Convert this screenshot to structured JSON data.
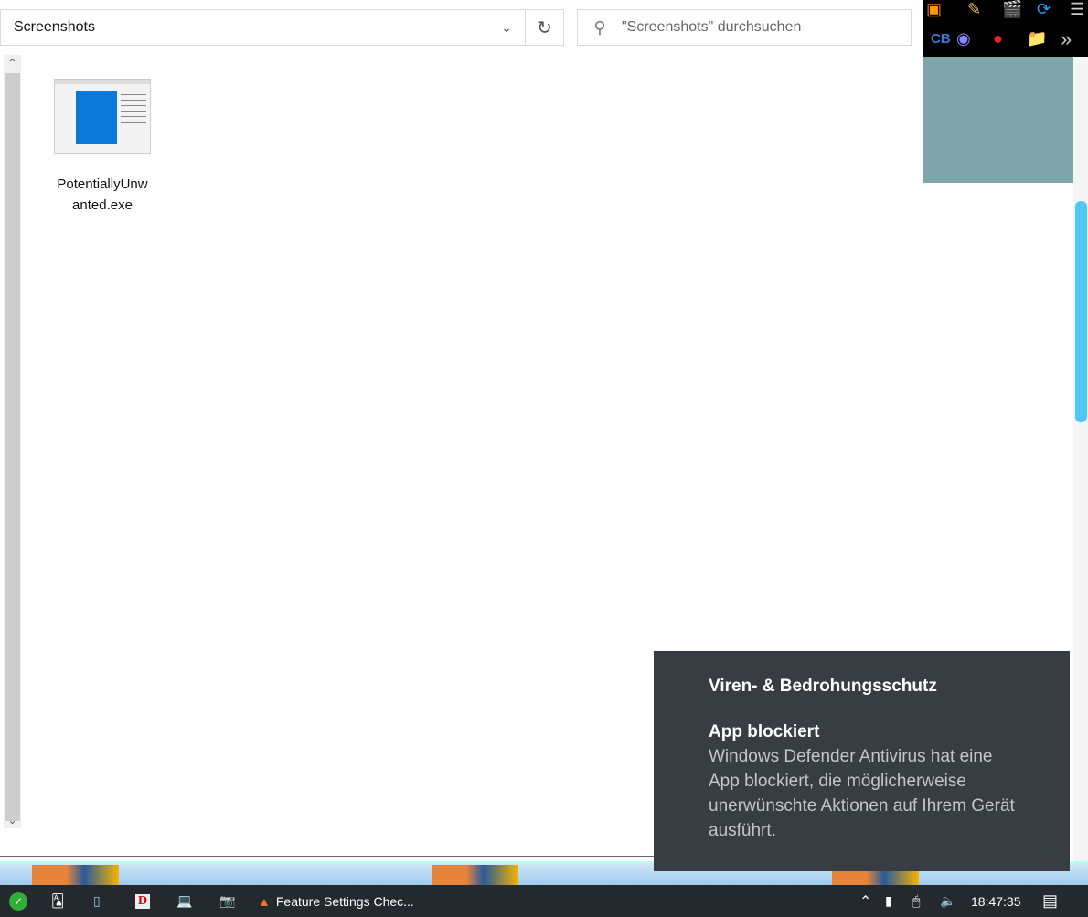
{
  "explorer": {
    "address": "Screenshots",
    "search_placeholder": "\"Screenshots\" durchsuchen",
    "files": [
      {
        "name": "PotentiallyUnwanted.exe",
        "label_line1": "PotentiallyUnw",
        "label_line2": "anted.exe"
      }
    ]
  },
  "toast": {
    "source": "Viren- & Bedrohungsschutz",
    "title": "App blockiert",
    "message": "Windows Defender Antivirus hat eine App blockiert, die möglicherweise unerwünschte Aktionen auf Ihrem Gerät ausführt."
  },
  "taskbar": {
    "window_title": "Feature Settings Chec...",
    "clock": "18:47:35"
  },
  "colors": {
    "toast_bg": "#373d42",
    "taskbar_bg": "#24292e",
    "accent": "#4fc8f5"
  }
}
